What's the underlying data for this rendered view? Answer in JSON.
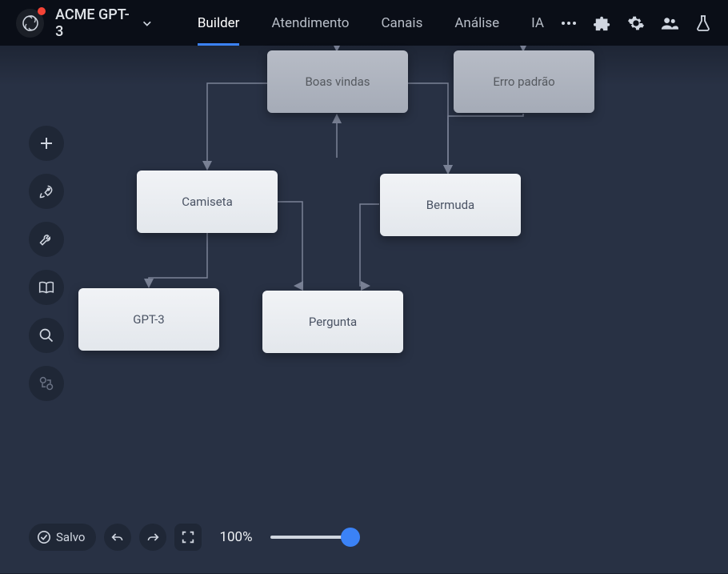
{
  "app": {
    "title": "ACME GPT-3"
  },
  "nav": {
    "items": [
      {
        "label": "Builder",
        "active": true
      },
      {
        "label": "Atendimento",
        "active": false
      },
      {
        "label": "Canais",
        "active": false
      },
      {
        "label": "Análise",
        "active": false
      },
      {
        "label": "IA",
        "active": false
      }
    ]
  },
  "nodes": {
    "boas_vindas": {
      "label": "Boas vindas"
    },
    "erro_padrao": {
      "label": "Erro padrão"
    },
    "camiseta": {
      "label": "Camiseta"
    },
    "bermuda": {
      "label": "Bermuda"
    },
    "gpt3": {
      "label": "GPT-3"
    },
    "pergunta": {
      "label": "Pergunta"
    }
  },
  "status": {
    "save_label": "Salvo",
    "zoom_label": "100%"
  },
  "icons": {
    "more": "more-icon",
    "puzzle": "puzzle-icon",
    "gear": "gear-icon",
    "people": "people-icon",
    "flask": "flask-icon",
    "plus": "plus-icon",
    "rocket": "rocket-icon",
    "wrench": "wrench-icon",
    "book": "book-icon",
    "search": "search-icon",
    "exchange": "exchange-icon",
    "undo": "undo-icon",
    "redo": "redo-icon",
    "fullscreen": "fullscreen-icon",
    "check": "check-icon"
  }
}
